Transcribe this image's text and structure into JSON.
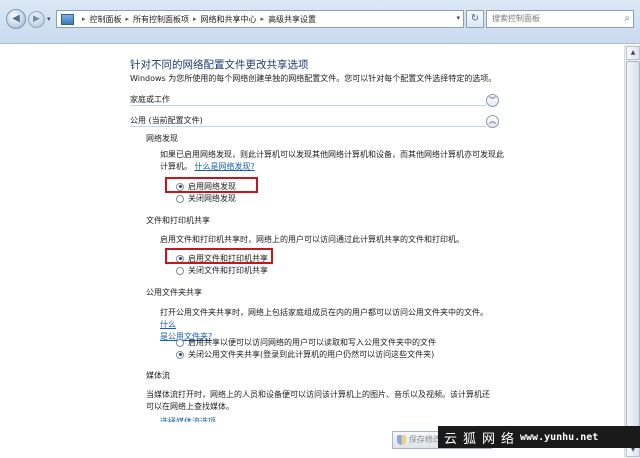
{
  "address_bar": {
    "breadcrumb": [
      "控制面板",
      "所有控制面板项",
      "网络和共享中心",
      "高级共享设置"
    ],
    "search_placeholder": "搜索控制面板"
  },
  "page": {
    "title": "针对不同的网络配置文件更改共享选项",
    "description": "Windows 为您所使用的每个网络创建单独的网络配置文件。您可以针对每个配置文件选择特定的选项。"
  },
  "profiles": {
    "home_work": {
      "label": "家庭或工作",
      "expanded": false
    },
    "public": {
      "label": "公用 (当前配置文件)",
      "expanded": true
    }
  },
  "network_discovery": {
    "title": "网络发现",
    "text_line1": "如果已启用网络发现，则此计算机可以发现其他网络计算机和设备，而其他网络计算机亦可发现此",
    "text_line2": "计算机。",
    "link": "什么是网络发现?",
    "options": [
      "启用网络发现",
      "关闭网络发现"
    ],
    "selected": 0
  },
  "file_printer_sharing": {
    "title": "文件和打印机共享",
    "text": "启用文件和打印机共享时，网络上的用户可以访问通过此计算机共享的文件和打印机。",
    "options": [
      "启用文件和打印机共享",
      "关闭文件和打印机共享"
    ],
    "selected": 0
  },
  "public_folder_sharing": {
    "title": "公用文件夹共享",
    "text_line1": "打开公用文件夹共享时，网络上包括家庭组成员在内的用户都可以访问公用文件夹中的文件。",
    "link_part1": "什么",
    "link_part2": "是公用文件夹?",
    "options": [
      "启用共享以便可以访问网络的用户可以读取和写入公用文件夹中的文件",
      "关闭公用文件夹共享(登录到此计算机的用户仍然可以访问这些文件夹)"
    ],
    "selected": 1
  },
  "media_streaming": {
    "title": "媒体流",
    "text_line1": "当媒体流打开时，网络上的人员和设备便可以访问该计算机上的图片、音乐以及视频。该计算机还",
    "text_line2": "可以在网络上查找媒体。",
    "link_cut": "选择媒体流选项..."
  },
  "footer": {
    "save_label": "保存修改"
  },
  "watermark": {
    "cn": "云狐网络",
    "url": "www.yunhu.net"
  }
}
